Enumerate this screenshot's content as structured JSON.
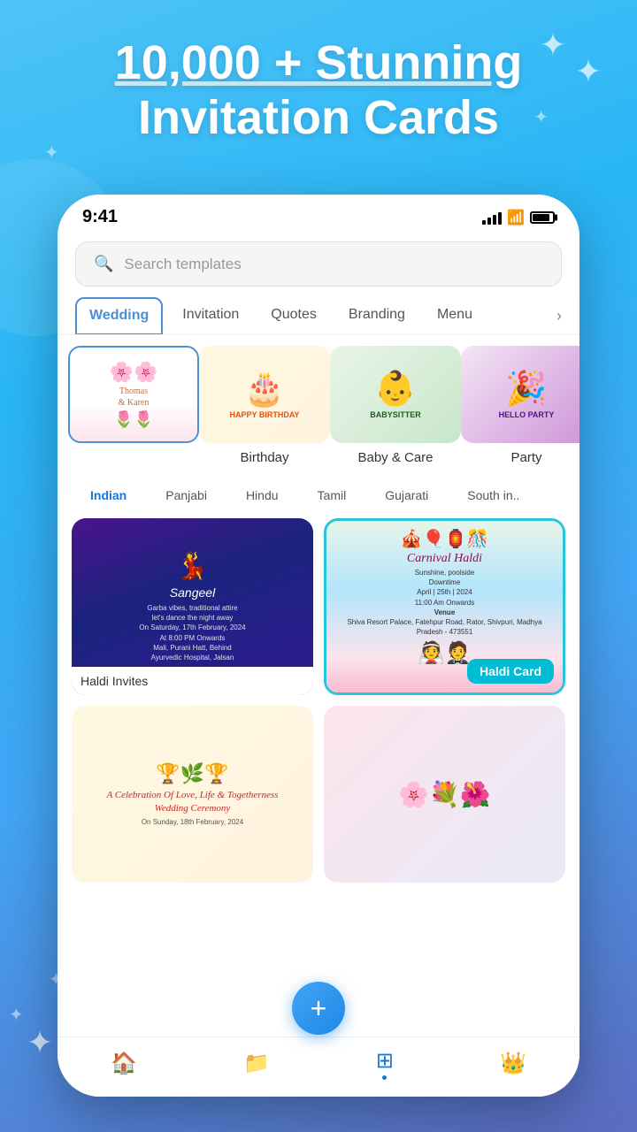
{
  "meta": {
    "background_gradient_start": "#4fc3f7",
    "background_gradient_end": "#5c6bc0"
  },
  "hero": {
    "title_line1": "10,000 + Stunning",
    "title_line2": "Invitation Cards"
  },
  "status_bar": {
    "time": "9:41",
    "signal": "signal-icon",
    "wifi": "wifi-icon",
    "battery": "battery-icon"
  },
  "search": {
    "placeholder": "Search templates"
  },
  "tabs": [
    {
      "label": "Wedding",
      "active": true
    },
    {
      "label": "Invitation",
      "active": false
    },
    {
      "label": "Quotes",
      "active": false
    },
    {
      "label": "Branding",
      "active": false
    },
    {
      "label": "Menu",
      "active": false
    }
  ],
  "categories": [
    {
      "id": "wedding",
      "label": "",
      "selected": true,
      "icon": "🌸"
    },
    {
      "id": "birthday",
      "label": "Birthday",
      "selected": false,
      "icon": "🎂"
    },
    {
      "id": "baby",
      "label": "Baby & Care",
      "selected": false,
      "icon": "👶"
    },
    {
      "id": "party",
      "label": "Party",
      "selected": false,
      "icon": "🎉"
    }
  ],
  "filters": [
    {
      "label": "Indian",
      "active": true
    },
    {
      "label": "Panjabi",
      "active": false
    },
    {
      "label": "Hindu",
      "active": false
    },
    {
      "label": "Tamil",
      "active": false
    },
    {
      "label": "Gujarati",
      "active": false
    },
    {
      "label": "South in..",
      "active": false
    }
  ],
  "cards": [
    {
      "id": "haldi-invites",
      "label": "Haldi Invites",
      "highlighted": false,
      "badge": null
    },
    {
      "id": "haldi-card",
      "label": "Haldi Card",
      "highlighted": true,
      "badge": "Haldi Card"
    },
    {
      "id": "wedding-ceremony",
      "label": "",
      "highlighted": false,
      "badge": null
    },
    {
      "id": "floral",
      "label": "",
      "highlighted": false,
      "badge": null
    }
  ],
  "carnival_card": {
    "title": "Carnival Haldi",
    "subtitle": "Sunshine, poolside",
    "subtitle2": "Downtime",
    "date": "April | 25th | 2024",
    "time": "11:00 Am Onwards",
    "venue_label": "Venue",
    "venue_detail": "Shiva Resort Palace, Fatehpur Road,\nRator, Shivpuri, Madhya Pradesh - 473551"
  },
  "haldi_invites_card": {
    "theme": "Sangeel",
    "tagline": "Garba vibes, traditional attire - let's dance the night away",
    "event": "Sangeel",
    "date": "On Saturday, 17th February, 2024",
    "time": "At 8:00 PM Onwards",
    "venue": "Mali, Purani Hatt, Behind Ayurvedic Hospital, Jalsan - Dist Jalsan."
  },
  "fab": {
    "label": "+"
  },
  "bottom_nav": [
    {
      "id": "home",
      "icon": "🏠",
      "active": false
    },
    {
      "id": "folders",
      "icon": "📁",
      "active": false
    },
    {
      "id": "grid",
      "icon": "⊞",
      "active": true
    },
    {
      "id": "crown",
      "icon": "👑",
      "active": false
    }
  ]
}
